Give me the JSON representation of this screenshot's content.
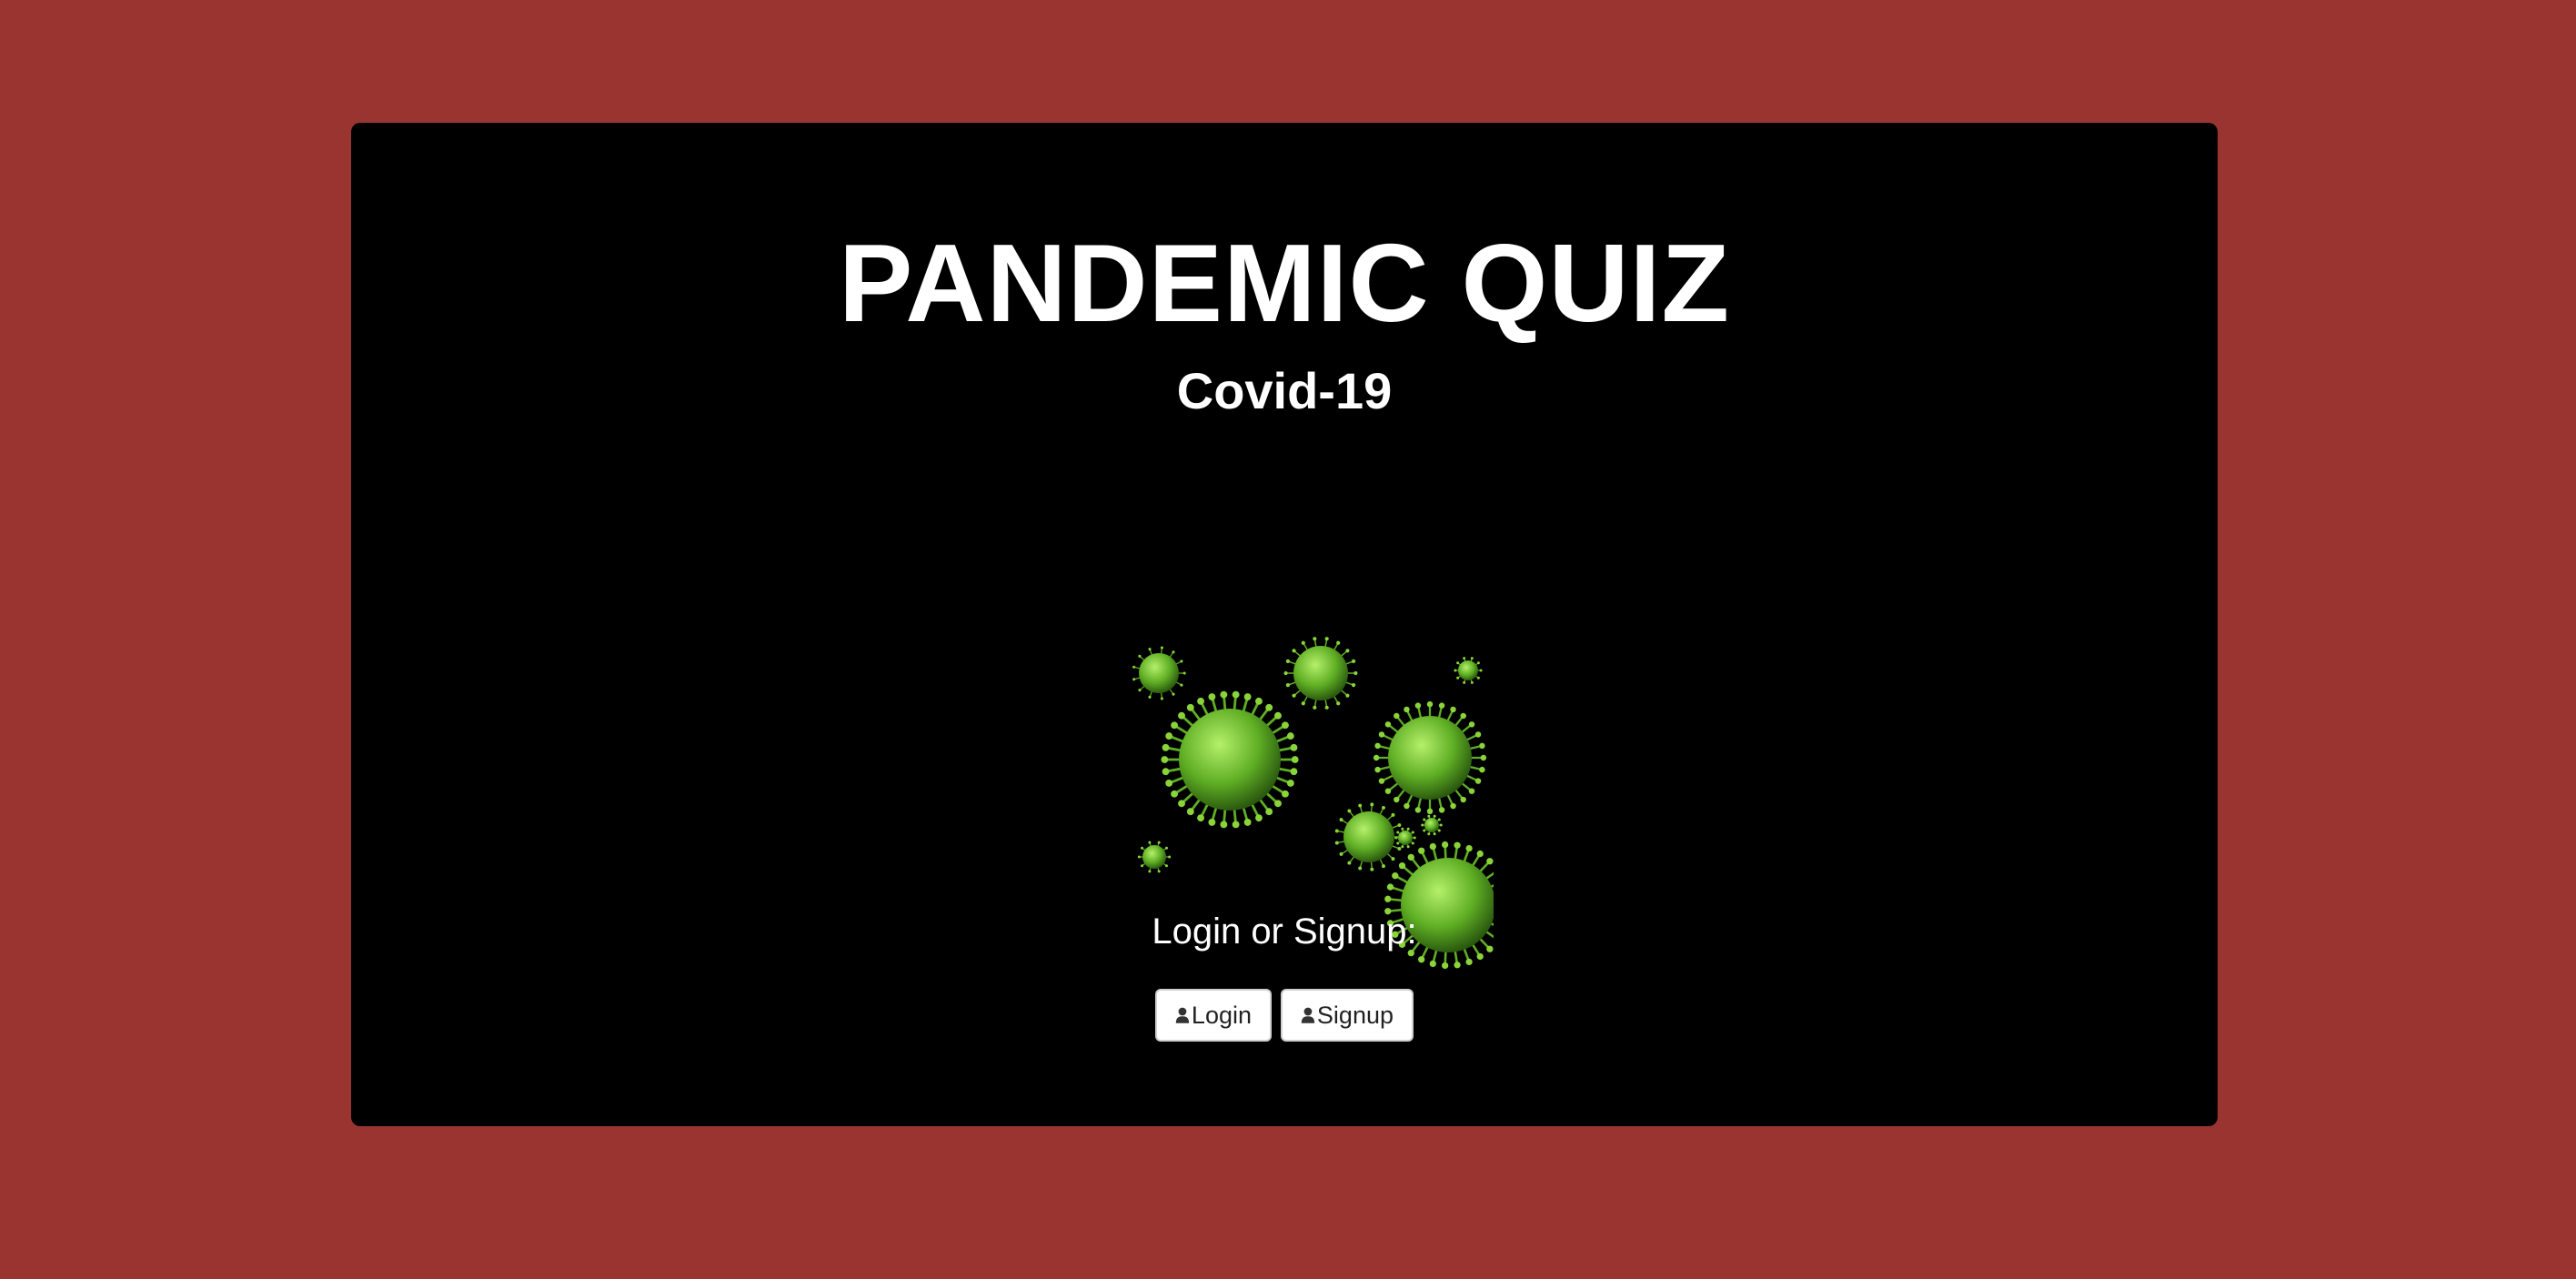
{
  "page": {
    "title": "PANDEMIC QUIZ",
    "subtitle": "Covid-19",
    "illustration_icon": "virus-cluster-image"
  },
  "auth": {
    "prompt": "Login or Signup:",
    "login_label": "Login",
    "signup_label": "Signup",
    "button_icon": "user-icon"
  },
  "colors": {
    "background": "#9a3431",
    "card": "#000000",
    "text": "#ffffff",
    "virus_green": "#6fbf2a"
  }
}
